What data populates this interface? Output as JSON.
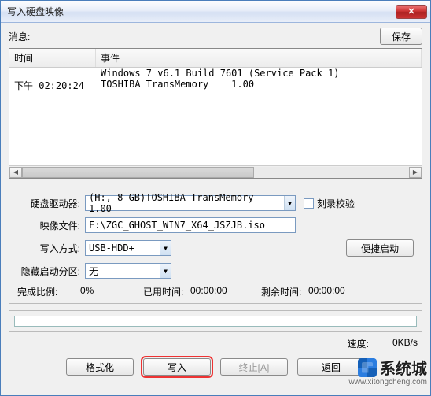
{
  "window": {
    "title": "写入硬盘映像"
  },
  "top": {
    "messages_label": "消息:",
    "save_btn": "保存"
  },
  "log": {
    "headers": {
      "time": "时间",
      "event": "事件"
    },
    "rows": [
      {
        "time": "",
        "event": "Windows 7 v6.1 Build 7601 (Service Pack 1)"
      },
      {
        "time": "下午 02:20:24",
        "event": "TOSHIBA TransMemory    1.00"
      }
    ]
  },
  "form": {
    "drive_label": "硬盘驱动器:",
    "drive_value": "(H:, 8 GB)TOSHIBA TransMemory    1.00",
    "verify_label": "刻录校验",
    "image_label": "映像文件:",
    "image_value": "F:\\ZGC_GHOST_WIN7_X64_JSZJB.iso",
    "mode_label": "写入方式:",
    "mode_value": "USB-HDD+",
    "quick_boot_btn": "便捷启动",
    "hidden_label": "隐藏启动分区:",
    "hidden_value": "无"
  },
  "stats": {
    "done_label": "完成比例:",
    "done_value": "0%",
    "elapsed_label": "已用时间:",
    "elapsed_value": "00:00:00",
    "remain_label": "剩余时间:",
    "remain_value": "00:00:00",
    "speed_label": "速度:",
    "speed_value": "0KB/s"
  },
  "buttons": {
    "format": "格式化",
    "write": "写入",
    "abort": "终止[A]",
    "back": "返回"
  },
  "watermark": {
    "brand": "系统城",
    "url": "www.xitongcheng.com"
  }
}
